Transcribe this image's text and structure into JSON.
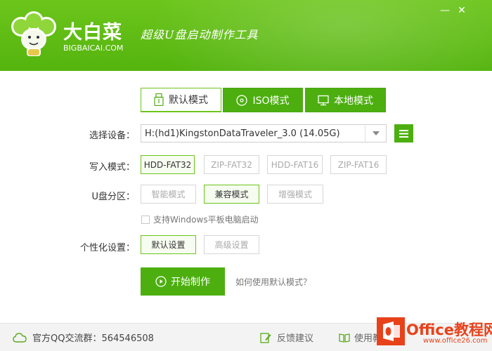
{
  "window": {
    "brand_name": "大白菜",
    "brand_domain": "BIGBAICAI.COM",
    "slogan": "超级U盘启动制作工具",
    "minimize_glyph": "—",
    "close_glyph": "✕"
  },
  "tabs": [
    {
      "label": "默认模式",
      "icon": "usb-icon",
      "active": true
    },
    {
      "label": "ISO模式",
      "icon": "disc-icon",
      "active": false
    },
    {
      "label": "本地模式",
      "icon": "monitor-icon",
      "active": false
    }
  ],
  "form": {
    "device_label": "选择设备：",
    "device_value": "H:(hd1)KingstonDataTraveler_3.0 (14.05G)",
    "write_mode_label": "写入模式：",
    "write_modes": [
      "HDD-FAT32",
      "ZIP-FAT32",
      "HDD-FAT16",
      "ZIP-FAT16"
    ],
    "write_mode_selected": "HDD-FAT32",
    "partition_label": "U盘分区：",
    "partition_modes": [
      "智能模式",
      "兼容模式",
      "增强模式"
    ],
    "partition_selected": "兼容模式",
    "windows_tablet_checkbox": "支持Windows平板电脑启动",
    "windows_tablet_checked": false,
    "personalize_label": "个性化设置：",
    "personalize_options": [
      "默认设置",
      "高级设置"
    ],
    "personalize_selected": "默认设置",
    "start_button": "开始制作",
    "help_link": "如何使用默认模式？"
  },
  "footer": {
    "qq_group": "官方QQ交流群：564546508",
    "feedback": "反馈建议",
    "tutorial": "使用教程"
  },
  "watermark": {
    "text": "Office教程网",
    "sub": "www.office26.com"
  },
  "colors": {
    "accent": "#4caf0f",
    "header_start": "#6cc51b",
    "watermark": "#e8421b"
  }
}
